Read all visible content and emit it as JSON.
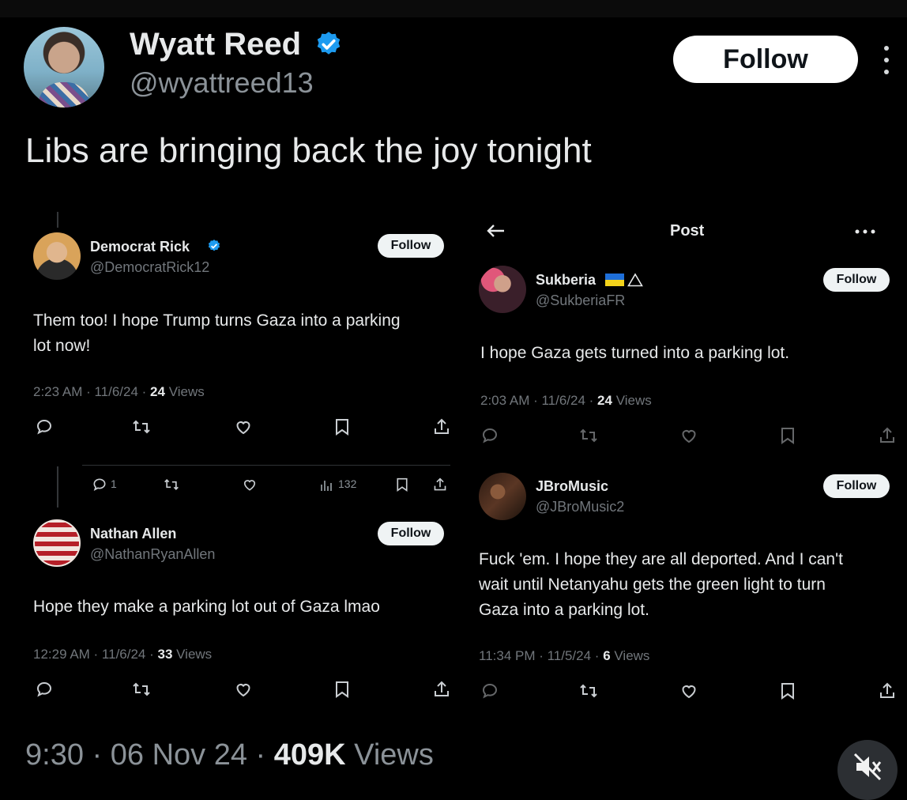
{
  "main": {
    "name": "Wyatt Reed",
    "handle": "@wyattreed13",
    "follow_label": "Follow",
    "text": "Libs are bringing back the joy tonight",
    "time": "9:30",
    "date": "06 Nov 24",
    "views_count": "409K",
    "views_label": "Views",
    "sep": "·"
  },
  "left_tweets": [
    {
      "name": "Democrat Rick",
      "handle": "@DemocratRick12",
      "follow_label": "Follow",
      "text_line1": "Them too! I hope Trump turns Gaza into a parking",
      "text_line2": "lot now!",
      "time": "2:23 AM · 11/6/24 · ",
      "views_count": "24",
      "views_label": " Views",
      "reply_count": "1",
      "analytics_count": "132"
    },
    {
      "name": "Nathan Allen",
      "handle": "@NathanRyanAllen",
      "follow_label": "Follow",
      "text_line1": "Hope they make a parking lot out of Gaza lmao",
      "time": "12:29 AM · 11/6/24 · ",
      "views_count": "33",
      "views_label": " Views"
    }
  ],
  "right_panel": {
    "header_title": "Post",
    "tweets": [
      {
        "name": "Sukberia",
        "handle": "@SukberiaFR",
        "follow_label": "Follow",
        "text_line1": "I hope Gaza gets turned into a parking lot.",
        "time": "2:03 AM · 11/6/24 · ",
        "views_count": "24",
        "views_label": " Views"
      },
      {
        "name": "JBroMusic",
        "handle": "@JBroMusic2",
        "follow_label": "Follow",
        "text_line1": "Fuck 'em.  I hope they are all deported.  And I can't",
        "text_line2": "wait until Netanyahu gets the green light to turn",
        "text_line3": "Gaza into a parking lot.",
        "time": "11:34 PM · 11/5/24 · ",
        "views_count": "6",
        "views_label": " Views"
      }
    ]
  },
  "colors": {
    "background": "#000000",
    "verified": "#1d9bf0",
    "muted_text": "#71767b"
  }
}
